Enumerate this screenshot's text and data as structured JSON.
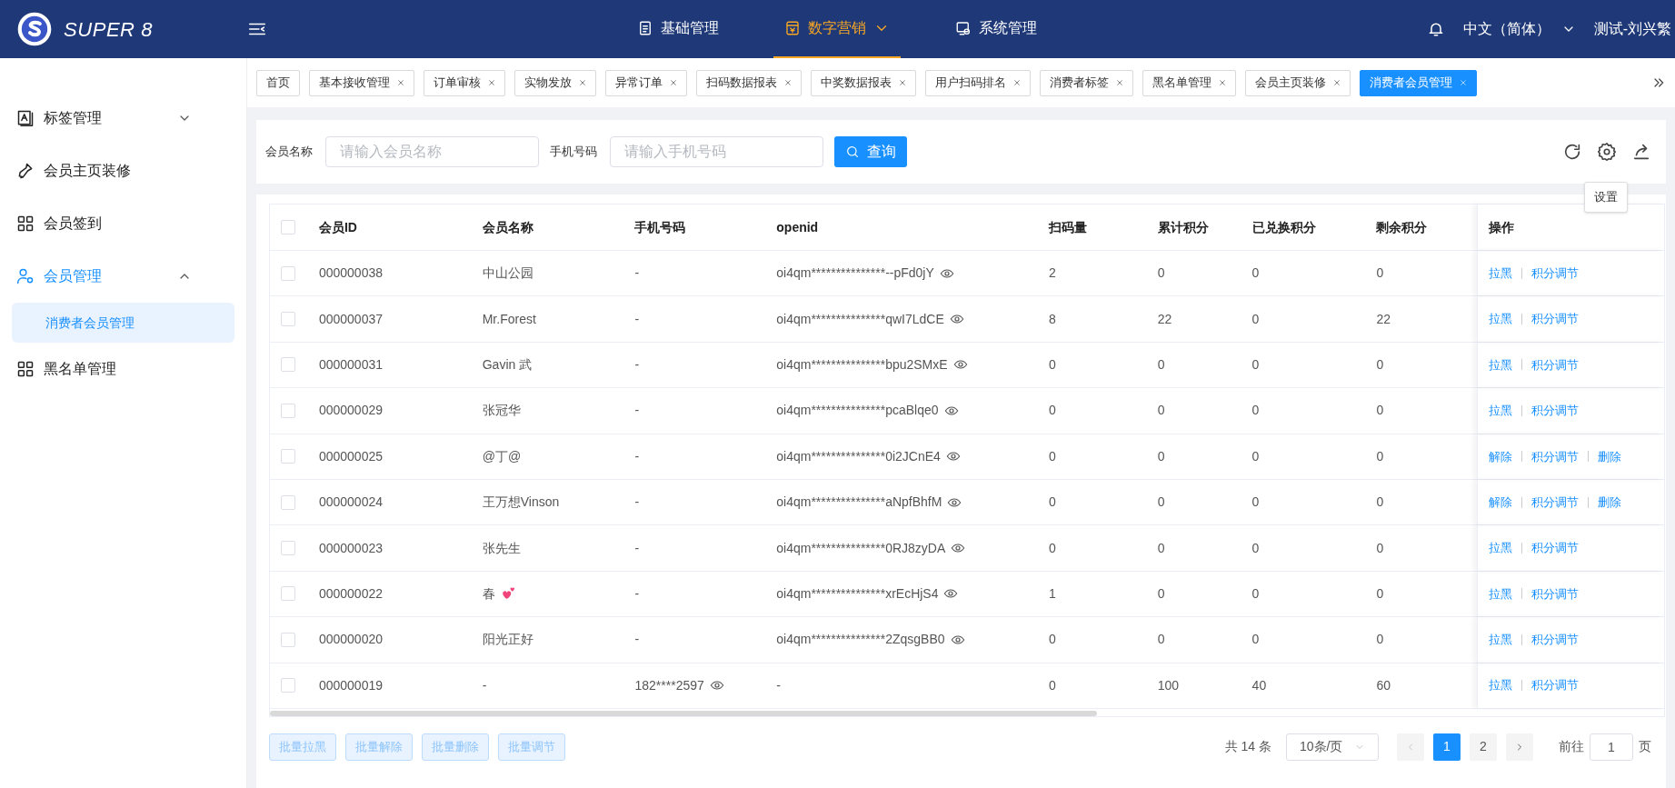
{
  "header": {
    "logo_text": "SUPER 8",
    "nav": [
      {
        "label": "基础管理",
        "selected": false,
        "dropdown": false
      },
      {
        "label": "数字营销",
        "selected": true,
        "dropdown": true
      },
      {
        "label": "系统管理",
        "selected": false,
        "dropdown": false
      }
    ],
    "language": "中文（简体）",
    "user": "测试-刘兴繁"
  },
  "sidebar": {
    "items": [
      {
        "label": "标签管理",
        "expandable": true,
        "expanded": false,
        "selected": false
      },
      {
        "label": "会员主页装修",
        "expandable": false,
        "selected": false
      },
      {
        "label": "会员签到",
        "expandable": false,
        "selected": false
      },
      {
        "label": "会员管理",
        "expandable": true,
        "expanded": true,
        "selected": true,
        "children": [
          {
            "label": "消费者会员管理",
            "selected": true
          }
        ]
      },
      {
        "label": "黑名单管理",
        "expandable": false,
        "selected": false
      }
    ]
  },
  "tabs": [
    {
      "label": "首页",
      "selected": false,
      "closable": false
    },
    {
      "label": "基本接收管理",
      "selected": false,
      "closable": true
    },
    {
      "label": "订单审核",
      "selected": false,
      "closable": true
    },
    {
      "label": "实物发放",
      "selected": false,
      "closable": true
    },
    {
      "label": "异常订单",
      "selected": false,
      "closable": true
    },
    {
      "label": "扫码数据报表",
      "selected": false,
      "closable": true
    },
    {
      "label": "中奖数据报表",
      "selected": false,
      "closable": true
    },
    {
      "label": "用户扫码排名",
      "selected": false,
      "closable": true
    },
    {
      "label": "消费者标签",
      "selected": false,
      "closable": true
    },
    {
      "label": "黑名单管理",
      "selected": false,
      "closable": true
    },
    {
      "label": "会员主页装修",
      "selected": false,
      "closable": true
    },
    {
      "label": "消费者会员管理",
      "selected": true,
      "closable": true
    }
  ],
  "search": {
    "fields": [
      {
        "label": "会员名称",
        "placeholder": "请输入会员名称"
      },
      {
        "label": "手机号码",
        "placeholder": "请输入手机号码"
      }
    ],
    "button": "查询",
    "tooltip": "设置"
  },
  "table": {
    "columns": [
      "会员ID",
      "会员名称",
      "手机号码",
      "openid",
      "扫码量",
      "累计积分",
      "已兑换积分",
      "剩余积分",
      "操作"
    ],
    "all_checked": false,
    "rows": [
      {
        "checked": false,
        "cells": [
          "000000038",
          "中山公园",
          "-",
          "oi4qm***************--pFd0jY",
          "2",
          "0",
          "0",
          "0"
        ],
        "heart": false,
        "phone_eye": false,
        "openid_eye": true,
        "actions": [
          "拉黑",
          "积分调节"
        ]
      },
      {
        "checked": false,
        "cells": [
          "000000037",
          "Mr.Forest",
          "-",
          "oi4qm***************qwI7LdCE",
          "8",
          "22",
          "0",
          "22"
        ],
        "heart": false,
        "phone_eye": false,
        "openid_eye": true,
        "actions": [
          "拉黑",
          "积分调节"
        ]
      },
      {
        "checked": false,
        "cells": [
          "000000031",
          "Gavin 武",
          "-",
          "oi4qm***************bpu2SMxE",
          "0",
          "0",
          "0",
          "0"
        ],
        "heart": false,
        "phone_eye": false,
        "openid_eye": true,
        "actions": [
          "拉黑",
          "积分调节"
        ]
      },
      {
        "checked": false,
        "cells": [
          "000000029",
          "张冠华",
          "-",
          "oi4qm***************pcaBlqe0",
          "0",
          "0",
          "0",
          "0"
        ],
        "heart": false,
        "phone_eye": false,
        "openid_eye": true,
        "actions": [
          "拉黑",
          "积分调节"
        ]
      },
      {
        "checked": false,
        "cells": [
          "000000025",
          "@丁@",
          "-",
          "oi4qm***************0i2JCnE4",
          "0",
          "0",
          "0",
          "0"
        ],
        "heart": false,
        "phone_eye": false,
        "openid_eye": true,
        "actions": [
          "解除",
          "积分调节",
          "删除"
        ]
      },
      {
        "checked": false,
        "cells": [
          "000000024",
          "王万想Vinson",
          "-",
          "oi4qm***************aNpfBhfM",
          "0",
          "0",
          "0",
          "0"
        ],
        "heart": false,
        "phone_eye": false,
        "openid_eye": true,
        "actions": [
          "解除",
          "积分调节",
          "删除"
        ]
      },
      {
        "checked": false,
        "cells": [
          "000000023",
          "张先生",
          "-",
          "oi4qm***************0RJ8zyDA",
          "0",
          "0",
          "0",
          "0"
        ],
        "heart": false,
        "phone_eye": false,
        "openid_eye": true,
        "actions": [
          "拉黑",
          "积分调节"
        ]
      },
      {
        "checked": false,
        "cells": [
          "000000022",
          "春",
          "-",
          "oi4qm***************xrEcHjS4",
          "1",
          "0",
          "0",
          "0"
        ],
        "heart": true,
        "phone_eye": false,
        "openid_eye": true,
        "actions": [
          "拉黑",
          "积分调节"
        ]
      },
      {
        "checked": false,
        "cells": [
          "000000020",
          "阳光正好",
          "-",
          "oi4qm***************2ZqsgBB0",
          "0",
          "0",
          "0",
          "0"
        ],
        "heart": false,
        "phone_eye": false,
        "openid_eye": true,
        "actions": [
          "拉黑",
          "积分调节"
        ]
      },
      {
        "checked": false,
        "cells": [
          "000000019",
          "-",
          "182****2597",
          "-",
          "0",
          "100",
          "40",
          "60"
        ],
        "heart": false,
        "phone_eye": true,
        "openid_eye": false,
        "actions": [
          "拉黑",
          "积分调节"
        ]
      }
    ]
  },
  "batch_buttons": [
    {
      "label": "批量拉黑",
      "disabled": true
    },
    {
      "label": "批量解除",
      "disabled": true
    },
    {
      "label": "批量删除",
      "disabled": true
    },
    {
      "label": "批量调节",
      "disabled": true
    }
  ],
  "pagination": {
    "total": "共 14 条",
    "page_size": "10条/页",
    "pages": [
      {
        "label": "1",
        "selected": true
      },
      {
        "label": "2",
        "selected": false
      }
    ],
    "goto": "前往",
    "goto_value": "1",
    "page_suffix": "页"
  }
}
